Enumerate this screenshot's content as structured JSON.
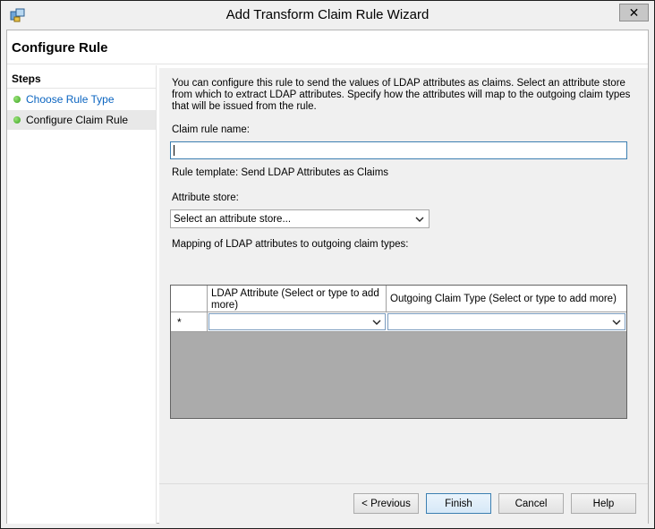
{
  "window": {
    "title": "Add Transform Claim Rule Wizard",
    "close_label": "✕"
  },
  "header": {
    "title": "Configure Rule"
  },
  "steps": {
    "title": "Steps",
    "items": [
      {
        "label": "Choose Rule Type",
        "state": "completed-link"
      },
      {
        "label": "Configure Claim Rule",
        "state": "current"
      }
    ]
  },
  "form": {
    "description": "You can configure this rule to send the values of LDAP attributes as claims. Select an attribute store from which to extract LDAP attributes. Specify how the attributes will map to the outgoing claim types that will be issued from the rule.",
    "claim_rule_name_label": "Claim rule name:",
    "claim_rule_name_value": "",
    "rule_template": "Rule template: Send LDAP Attributes as Claims",
    "attribute_store_label": "Attribute store:",
    "attribute_store_value": "Select an attribute store...",
    "mapping_label": "Mapping of LDAP attributes to outgoing claim types:"
  },
  "grid": {
    "columns": [
      "LDAP Attribute (Select or type to add more)",
      "Outgoing Claim Type (Select or type to add more)"
    ],
    "new_row_marker": "*",
    "rows": [
      {
        "ldap_attribute": "",
        "outgoing_claim_type": ""
      }
    ]
  },
  "buttons": {
    "previous": "< Previous",
    "finish": "Finish",
    "cancel": "Cancel",
    "help": "Help"
  },
  "colors": {
    "link": "#0a64c0",
    "step_dot": "#3aa320",
    "focus_border": "#3c7fb1"
  }
}
